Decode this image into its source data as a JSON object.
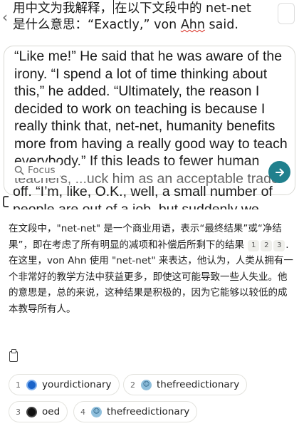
{
  "query": {
    "line1_before_caret": "用中文为我解释，",
    "line1_after_caret": "在以下文段中的 net-net",
    "line2_before_name": "是什么意思：“Exactly,” von ",
    "line2_name": "Ahn",
    "line2_after_name": " said."
  },
  "input_box": {
    "text": "“Like me!” He said that he was aware of the irony. “I spend a lot of time thinking about this,” he added. “Ultimately, the reason I decided to work on teaching is because I really think that, net-net, humanity benefits more from having a really good way to teach everybody.” If this leads to fewer human teachers, ...uck him as an acceptable trade",
    "overflow_line1": "off. “I’m, like, O.K., well, a small number of",
    "overflow_line2": "people are out of a job, but suddenly we"
  },
  "focus_label": "Focus",
  "answer": {
    "part1": "在文段中，\"net-net\" 是一个商业用语，表示“最终结果”或“净结果”，即在考虑了所有明显的减项和补偿后所剩下的结果",
    "part2": ". 在这里，von Ahn 使用 \"net-net\" 来表达，他认为，人类从拥有一个非常好的教学方法中获益更多，即使这可能导致一些人失业。他的意思是，总的来说，这种结果是积极的，因为它能够以较低的成本教导所有人。",
    "citations": [
      "1",
      "2",
      "3"
    ]
  },
  "sources": [
    {
      "num": "1",
      "name": "yourdictionary",
      "icon": "yourdictionary-icon"
    },
    {
      "num": "2",
      "name": "thefreedictionary",
      "icon": "thefreedictionary-icon"
    },
    {
      "num": "3",
      "name": "oed",
      "icon": "oed-icon"
    },
    {
      "num": "4",
      "name": "thefreedictionary",
      "icon": "thefreedictionary-icon"
    }
  ],
  "colors": {
    "accent": "#20808d",
    "border": "#d9d9d4",
    "chip_border": "#e3e3de"
  }
}
